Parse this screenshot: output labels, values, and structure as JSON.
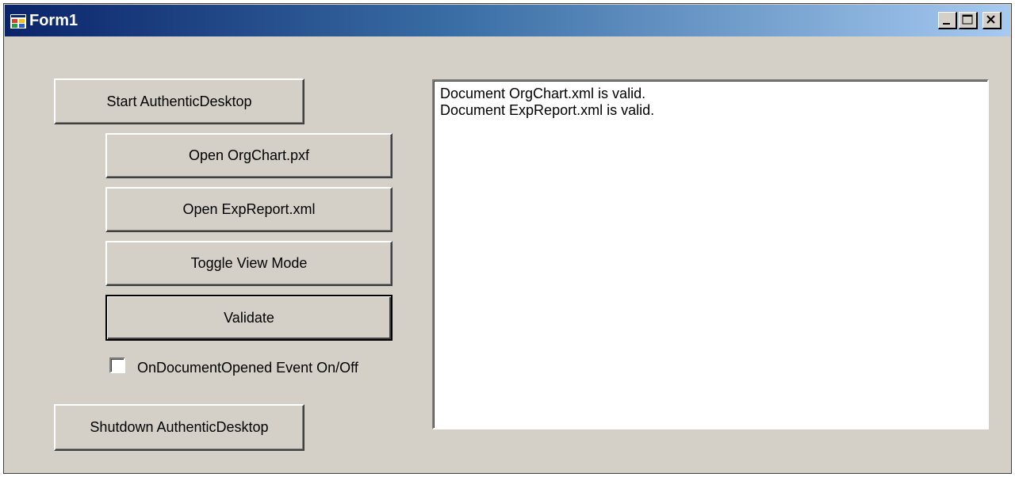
{
  "window": {
    "title": "Form1",
    "title_icon": "form-app-icon",
    "controls": {
      "minimize_icon": "minimize-icon",
      "maximize_icon": "maximize-icon",
      "close_icon": "close-icon"
    },
    "colors": {
      "title_gradient_start": "#0a246a",
      "title_gradient_end": "#a6caf0",
      "face": "#d4d0c8"
    }
  },
  "buttons": {
    "start": "Start AuthenticDesktop",
    "open_orgchart": "Open OrgChart.pxf",
    "open_expreport": "Open ExpReport.xml",
    "toggle_view": "Toggle View Mode",
    "validate": "Validate",
    "shutdown": "Shutdown AuthenticDesktop"
  },
  "checkbox": {
    "label": "OnDocumentOpened Event On/Off",
    "checked": false
  },
  "log": {
    "lines": [
      "Document OrgChart.xml is valid.",
      "Document ExpReport.xml is valid."
    ]
  }
}
